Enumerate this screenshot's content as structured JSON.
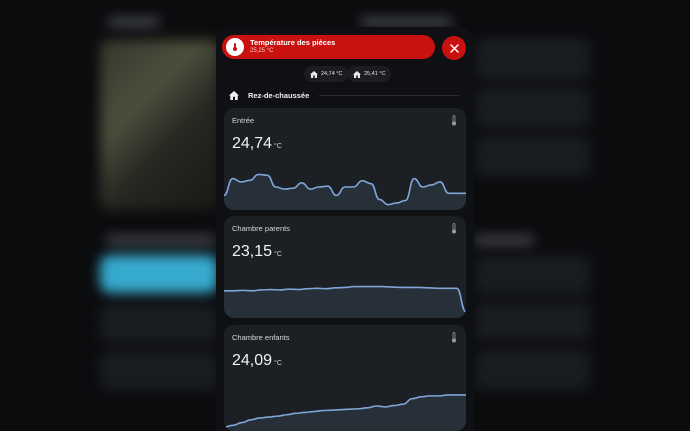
{
  "dialog": {
    "title": "Température des pièces",
    "subtitle": "25,25 °C",
    "close_icon": "close-icon",
    "header_icon": "thermometer-icon",
    "accent": "#c9110f"
  },
  "chips": [
    {
      "icon": "home-icon",
      "value": "24,74 °C"
    },
    {
      "icon": "home-icon",
      "value": "25,41 °C"
    }
  ],
  "section": {
    "icon": "home-icon",
    "label": "Rez-de-chaussée"
  },
  "rooms": [
    {
      "name": "Entrée",
      "value": "24,74",
      "unit": "°C",
      "icon": "thermometer-icon",
      "trend": [
        0.3,
        0.7,
        0.62,
        0.66,
        0.8,
        0.78,
        0.5,
        0.45,
        0.47,
        0.6,
        0.45,
        0.5,
        0.52,
        0.3,
        0.5,
        0.5,
        0.65,
        0.58,
        0.2,
        0.08,
        0.12,
        0.18,
        0.7,
        0.5,
        0.55,
        0.62,
        0.35,
        0.35,
        0.35
      ]
    },
    {
      "name": "Chambre parents",
      "value": "23,15",
      "unit": "°C",
      "icon": "thermometer-icon",
      "trend": [
        0.6,
        0.6,
        0.61,
        0.6,
        0.62,
        0.63,
        0.62,
        0.64,
        0.63,
        0.65,
        0.66,
        0.65,
        0.67,
        0.68,
        0.7,
        0.7,
        0.7,
        0.7,
        0.69,
        0.68,
        0.68,
        0.68,
        0.67,
        0.66,
        0.66,
        0.66,
        0.1
      ]
    },
    {
      "name": "Chambre enfants",
      "value": "24,09",
      "unit": "°C",
      "icon": "thermometer-icon",
      "trend": [
        0.04,
        0.08,
        0.14,
        0.2,
        0.24,
        0.26,
        0.28,
        0.31,
        0.34,
        0.36,
        0.38,
        0.4,
        0.41,
        0.42,
        0.43,
        0.44,
        0.46,
        0.5,
        0.48,
        0.51,
        0.54,
        0.66,
        0.7,
        0.72,
        0.72,
        0.74,
        0.74,
        0.74
      ]
    }
  ],
  "graph_color": "#7fa6d6"
}
